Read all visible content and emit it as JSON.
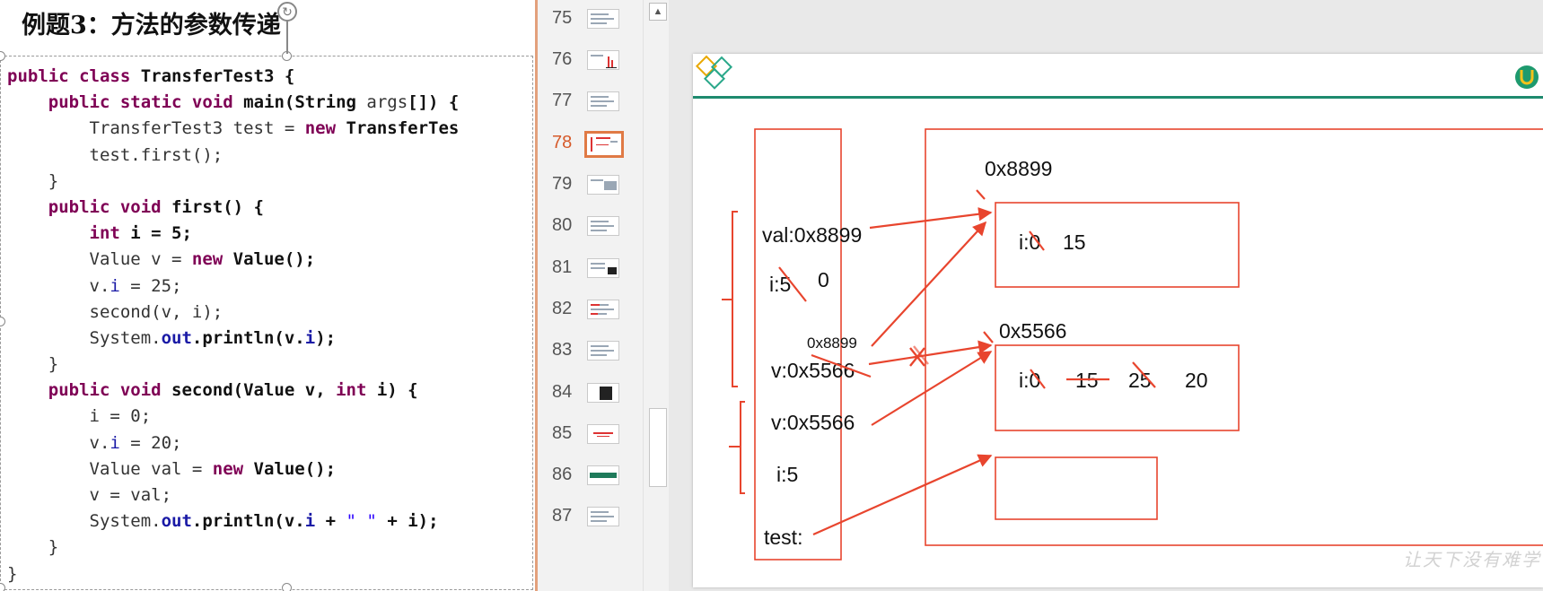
{
  "code_panel": {
    "title": "例题3：方法的参数传递",
    "lines": [
      [
        [
          "kw",
          "public "
        ],
        [
          "kw",
          "class "
        ],
        [
          "bd",
          "TransferTest3 {"
        ]
      ],
      [
        [
          "nm",
          "    "
        ],
        [
          "kw",
          "public "
        ],
        [
          "kw",
          "static "
        ],
        [
          "kw",
          "void "
        ],
        [
          "bd",
          "main(String "
        ],
        [
          "nm",
          "args"
        ],
        [
          "bd",
          "[]) {"
        ]
      ],
      [
        [
          "nm",
          "        TransferTest3 test = "
        ],
        [
          "kw",
          "new "
        ],
        [
          "bd",
          "TransferTes"
        ]
      ],
      [
        [
          "nm",
          "        test.first();"
        ]
      ],
      [
        [
          "nm",
          "    }"
        ]
      ],
      [
        [
          "nm",
          "    "
        ],
        [
          "kw",
          "public "
        ],
        [
          "kw",
          "void "
        ],
        [
          "bd",
          "first() {"
        ]
      ],
      [
        [
          "nm",
          "        "
        ],
        [
          "kw",
          "int "
        ],
        [
          "bd",
          "i = 5;"
        ]
      ],
      [
        [
          "nm",
          "        Value v = "
        ],
        [
          "kw",
          "new "
        ],
        [
          "bd",
          "Value();"
        ]
      ],
      [
        [
          "nm",
          "        v."
        ],
        [
          "fld",
          "i"
        ],
        [
          "nm",
          " = 25;"
        ]
      ],
      [
        [
          "nm",
          "        second(v, i);"
        ]
      ],
      [
        [
          "nm",
          "        System."
        ],
        [
          "fldb",
          "out"
        ],
        [
          "bd",
          ".println(v."
        ],
        [
          "fldb",
          "i"
        ],
        [
          "bd",
          ");"
        ]
      ],
      [
        [
          "nm",
          "    }"
        ]
      ],
      [
        [
          "nm",
          "    "
        ],
        [
          "kw",
          "public "
        ],
        [
          "kw",
          "void "
        ],
        [
          "bd",
          "second(Value v, "
        ],
        [
          "kw",
          "int "
        ],
        [
          "bd",
          "i) {"
        ]
      ],
      [
        [
          "nm",
          "        i = 0;"
        ]
      ],
      [
        [
          "nm",
          "        v."
        ],
        [
          "fld",
          "i"
        ],
        [
          "nm",
          " = 20;"
        ]
      ],
      [
        [
          "nm",
          "        Value val = "
        ],
        [
          "kw",
          "new "
        ],
        [
          "bd",
          "Value();"
        ]
      ],
      [
        [
          "nm",
          "        v = val;"
        ]
      ],
      [
        [
          "nm",
          "        System."
        ],
        [
          "fldb",
          "out"
        ],
        [
          "bd",
          ".println(v."
        ],
        [
          "fldb",
          "i"
        ],
        [
          "bd",
          " + "
        ],
        [
          "str",
          "\" \""
        ],
        [
          "bd",
          " + i);"
        ]
      ],
      [
        [
          "nm",
          "    }"
        ]
      ],
      [
        [
          "nm",
          "}"
        ]
      ]
    ]
  },
  "thumbnails": {
    "active": "78",
    "items": [
      {
        "num": "75",
        "style": "text"
      },
      {
        "num": "76",
        "style": "chart"
      },
      {
        "num": "77",
        "style": "text"
      },
      {
        "num": "78",
        "style": "diagram"
      },
      {
        "num": "79",
        "style": "image"
      },
      {
        "num": "80",
        "style": "text"
      },
      {
        "num": "81",
        "style": "dark"
      },
      {
        "num": "82",
        "style": "text-red"
      },
      {
        "num": "83",
        "style": "text"
      },
      {
        "num": "84",
        "style": "black"
      },
      {
        "num": "85",
        "style": "red"
      },
      {
        "num": "86",
        "style": "green"
      },
      {
        "num": "87",
        "style": "text"
      }
    ]
  },
  "diagram": {
    "stack_entries": {
      "val": "val:0x8899",
      "i_first": "i:5",
      "i_first_new": "0",
      "small_addr": "0x8899",
      "v_first": "v:0x5566",
      "v_main": "v:0x5566",
      "i_main": "i:5",
      "test": "test:"
    },
    "heap": {
      "addr_top": "0x8899",
      "obj_top_field": "i:0",
      "obj_top_value": "15",
      "addr_mid": "0x5566",
      "obj_mid_field": "i:0",
      "obj_mid_values": [
        "15",
        "25",
        "20"
      ]
    },
    "annotation_color": "#e8452e"
  },
  "watermark": "让天下没有难学"
}
